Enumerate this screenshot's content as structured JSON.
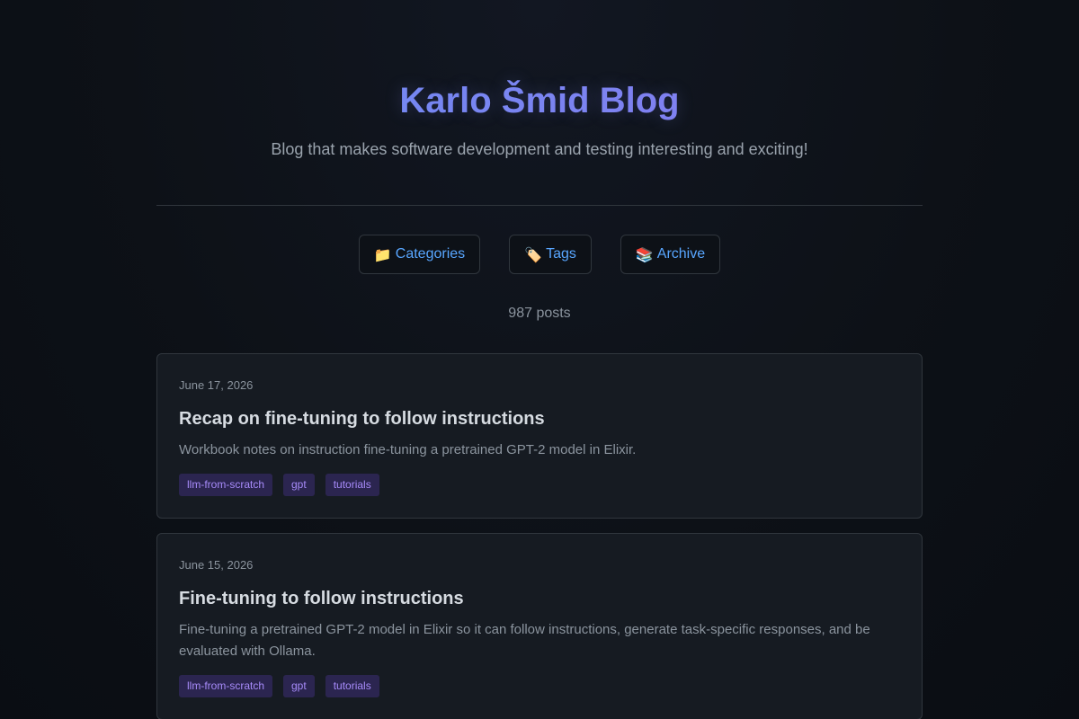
{
  "site": {
    "title": "Karlo Šmid Blog",
    "subtitle": "Blog that makes software development and testing interesting and exciting!"
  },
  "nav": [
    {
      "icon": "📁",
      "icon_name": "folder-icon",
      "label": "Categories"
    },
    {
      "icon": "🏷️",
      "icon_name": "tag-icon",
      "label": "Tags"
    },
    {
      "icon": "📚",
      "icon_name": "books-icon",
      "label": "Archive"
    }
  ],
  "post_count": "987 posts",
  "posts": [
    {
      "date": "June 17, 2026",
      "title": "Recap on fine-tuning to follow instructions",
      "excerpt": "Workbook notes on instruction fine-tuning a pretrained GPT-2 model in Elixir.",
      "tags": [
        "llm-from-scratch",
        "gpt",
        "tutorials"
      ]
    },
    {
      "date": "June 15, 2026",
      "title": "Fine-tuning to follow instructions",
      "excerpt": "Fine-tuning a pretrained GPT-2 model in Elixir so it can follow instructions, generate task-specific responses, and be evaluated with Ollama.",
      "tags": [
        "llm-from-scratch",
        "gpt",
        "tutorials"
      ]
    }
  ],
  "colors": {
    "background": "#0d1117",
    "card": "#161b22",
    "border": "#30363d",
    "title_gradient_start": "#6e8ff5",
    "title_gradient_end": "#8a7cf0",
    "link": "#58a6ff",
    "tag_bg": "#2b2550",
    "tag_text": "#a78bfa"
  }
}
